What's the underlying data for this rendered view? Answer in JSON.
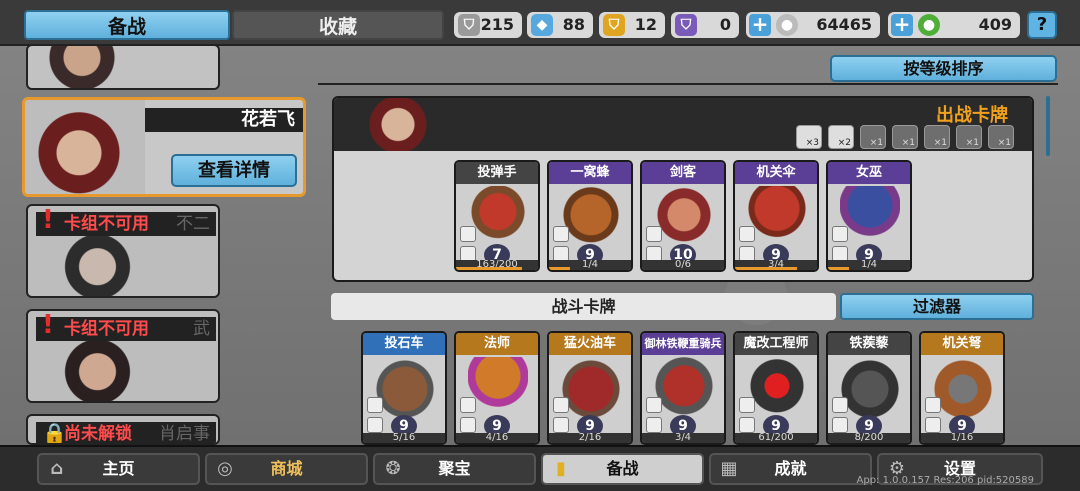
{
  "tabs": {
    "active": "备战",
    "inactive": "收藏"
  },
  "resources": [
    {
      "icon": "silver-shield-icon",
      "value": "215",
      "color": "#9a9a9a"
    },
    {
      "icon": "blue-crystal-icon",
      "value": "88",
      "color": "#58a8e0"
    },
    {
      "icon": "gold-badge-icon",
      "value": "12",
      "color": "#e0a520"
    },
    {
      "icon": "purple-badge-icon",
      "value": "0",
      "color": "#7a5ab8"
    }
  ],
  "currency": [
    {
      "value": "64465",
      "icon": "silver-coin-icon"
    },
    {
      "value": "409",
      "icon": "green-gem-icon"
    }
  ],
  "help_label": "?",
  "sort_label": "按等级排序",
  "left": {
    "selected": {
      "name": "花若飞",
      "detail_button": "查看详情"
    },
    "decks": [
      {
        "status": "卡组不可用",
        "name": "不二"
      },
      {
        "status": "卡组不可用",
        "name": "武"
      },
      {
        "status": "尚未解锁",
        "name": "肖启事"
      }
    ]
  },
  "deck_title": "出战卡牌",
  "slot_labels": [
    "×3",
    "×2",
    "×1",
    "×1",
    "×1",
    "×1",
    "×1"
  ],
  "deck_cards": [
    {
      "name": "投弹手",
      "level": "7",
      "progress": "163/200",
      "rarity": "gray",
      "fill": 0.8
    },
    {
      "name": "一窝蜂",
      "level": "9",
      "progress": "1/4",
      "rarity": "purple",
      "fill": 0.25
    },
    {
      "name": "剑客",
      "level": "10",
      "progress": "0/6",
      "rarity": "purple",
      "fill": 0
    },
    {
      "name": "机关伞",
      "level": "9",
      "progress": "3/4",
      "rarity": "purple",
      "fill": 0.75
    },
    {
      "name": "女巫",
      "level": "9",
      "progress": "1/4",
      "rarity": "purple",
      "fill": 0.25
    }
  ],
  "battle_title": "战斗卡牌",
  "filter_label": "过滤器",
  "battle_cards": [
    {
      "name": "投石车",
      "level": "9",
      "progress": "5/16",
      "rarity": "blue"
    },
    {
      "name": "法师",
      "level": "9",
      "progress": "4/16",
      "rarity": "gold"
    },
    {
      "name": "猛火油车",
      "level": "9",
      "progress": "2/16",
      "rarity": "gold"
    },
    {
      "name": "御林铁鞭重骑兵",
      "level": "9",
      "progress": "3/4",
      "rarity": "purple"
    },
    {
      "name": "魔改工程师",
      "level": "9",
      "progress": "61/200",
      "rarity": "gray"
    },
    {
      "name": "铁蒺藜",
      "level": "9",
      "progress": "8/200",
      "rarity": "gray"
    },
    {
      "name": "机关弩",
      "level": "9",
      "progress": "1/16",
      "rarity": "gold"
    }
  ],
  "nav": [
    {
      "label": "主页",
      "icon": "home-icon"
    },
    {
      "label": "商城",
      "icon": "shop-icon"
    },
    {
      "label": "聚宝",
      "icon": "treasure-icon"
    },
    {
      "label": "备战",
      "icon": "cards-icon"
    },
    {
      "label": "成就",
      "icon": "achievement-icon"
    },
    {
      "label": "设置",
      "icon": "gear-icon"
    }
  ],
  "version": "App: 1.0.0.157 Res:206 pid:520589"
}
